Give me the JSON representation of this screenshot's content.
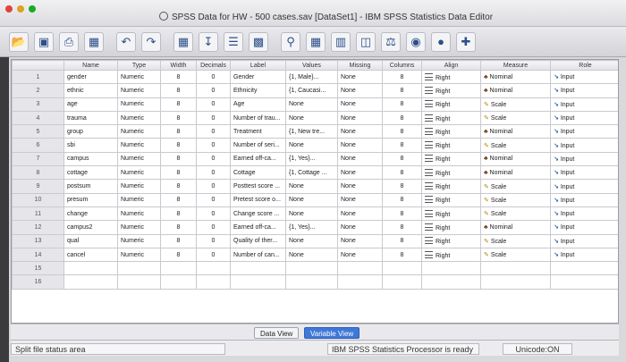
{
  "window": {
    "title": "SPSS Data for HW - 500 cases.sav [DataSet1] - IBM SPSS Statistics Data Editor"
  },
  "toolbar": {
    "icons": [
      "folder-open-icon",
      "save-icon",
      "print-icon",
      "dialog-recall-icon",
      "undo-icon",
      "redo-icon",
      "goto-case-icon",
      "goto-variable-icon",
      "variables-icon",
      "run-descriptives-icon",
      "find-icon",
      "insert-cases-icon",
      "insert-variable-icon",
      "split-file-icon",
      "weight-cases-icon",
      "select-cases-icon",
      "value-labels-icon",
      "use-sets-icon"
    ]
  },
  "grid": {
    "columns": [
      "",
      "Name",
      "Type",
      "Width",
      "Decimals",
      "Label",
      "Values",
      "Missing",
      "Columns",
      "Align",
      "Measure",
      "Role"
    ],
    "rows": [
      {
        "num": "1",
        "name": "gender",
        "type": "Numeric",
        "width": "8",
        "decimals": "0",
        "label": "Gender",
        "values": "{1, Male}...",
        "missing": "None",
        "columns": "8",
        "align": "Right",
        "measure": "Nominal",
        "role": "Input"
      },
      {
        "num": "2",
        "name": "ethnic",
        "type": "Numeric",
        "width": "8",
        "decimals": "0",
        "label": "Ethnicity",
        "values": "{1, Caucasi...",
        "missing": "None",
        "columns": "8",
        "align": "Right",
        "measure": "Nominal",
        "role": "Input"
      },
      {
        "num": "3",
        "name": "age",
        "type": "Numeric",
        "width": "8",
        "decimals": "0",
        "label": "Age",
        "values": "None",
        "missing": "None",
        "columns": "8",
        "align": "Right",
        "measure": "Scale",
        "role": "Input"
      },
      {
        "num": "4",
        "name": "trauma",
        "type": "Numeric",
        "width": "8",
        "decimals": "0",
        "label": "Number of trau...",
        "values": "None",
        "missing": "None",
        "columns": "8",
        "align": "Right",
        "measure": "Scale",
        "role": "Input"
      },
      {
        "num": "5",
        "name": "group",
        "type": "Numeric",
        "width": "8",
        "decimals": "0",
        "label": "Treatment",
        "values": "{1, New tre...",
        "missing": "None",
        "columns": "8",
        "align": "Right",
        "measure": "Nominal",
        "role": "Input"
      },
      {
        "num": "6",
        "name": "sbi",
        "type": "Numeric",
        "width": "8",
        "decimals": "0",
        "label": "Number of seri...",
        "values": "None",
        "missing": "None",
        "columns": "8",
        "align": "Right",
        "measure": "Scale",
        "role": "Input"
      },
      {
        "num": "7",
        "name": "campus",
        "type": "Numeric",
        "width": "8",
        "decimals": "0",
        "label": "Earned off-ca...",
        "values": "{1, Yes}...",
        "missing": "None",
        "columns": "8",
        "align": "Right",
        "measure": "Nominal",
        "role": "Input"
      },
      {
        "num": "8",
        "name": "cottage",
        "type": "Numeric",
        "width": "8",
        "decimals": "0",
        "label": "Cottage",
        "values": "{1, Cottage ...",
        "missing": "None",
        "columns": "8",
        "align": "Right",
        "measure": "Nominal",
        "role": "Input"
      },
      {
        "num": "9",
        "name": "postsum",
        "type": "Numeric",
        "width": "8",
        "decimals": "0",
        "label": "Posttest score ...",
        "values": "None",
        "missing": "None",
        "columns": "8",
        "align": "Right",
        "measure": "Scale",
        "role": "Input"
      },
      {
        "num": "10",
        "name": "presum",
        "type": "Numeric",
        "width": "8",
        "decimals": "0",
        "label": "Pretest score o...",
        "values": "None",
        "missing": "None",
        "columns": "8",
        "align": "Right",
        "measure": "Scale",
        "role": "Input"
      },
      {
        "num": "11",
        "name": "change",
        "type": "Numeric",
        "width": "8",
        "decimals": "0",
        "label": "Change score ...",
        "values": "None",
        "missing": "None",
        "columns": "8",
        "align": "Right",
        "measure": "Scale",
        "role": "Input"
      },
      {
        "num": "12",
        "name": "campus2",
        "type": "Numeric",
        "width": "8",
        "decimals": "0",
        "label": "Earned off-ca...",
        "values": "{1, Yes}...",
        "missing": "None",
        "columns": "8",
        "align": "Right",
        "measure": "Nominal",
        "role": "Input"
      },
      {
        "num": "13",
        "name": "qual",
        "type": "Numeric",
        "width": "8",
        "decimals": "0",
        "label": "Quality of ther...",
        "values": "None",
        "missing": "None",
        "columns": "8",
        "align": "Right",
        "measure": "Scale",
        "role": "Input"
      },
      {
        "num": "14",
        "name": "cancel",
        "type": "Numeric",
        "width": "8",
        "decimals": "0",
        "label": "Number of can...",
        "values": "None",
        "missing": "None",
        "columns": "8",
        "align": "Right",
        "measure": "Scale",
        "role": "Input"
      },
      {
        "num": "15",
        "name": "",
        "type": "",
        "width": "",
        "decimals": "",
        "label": "",
        "values": "",
        "missing": "",
        "columns": "",
        "align": "",
        "measure": "",
        "role": ""
      },
      {
        "num": "16",
        "name": "",
        "type": "",
        "width": "",
        "decimals": "",
        "label": "",
        "values": "",
        "missing": "",
        "columns": "",
        "align": "",
        "measure": "",
        "role": ""
      }
    ]
  },
  "tabs": {
    "data_view": "Data View",
    "variable_view": "Variable View",
    "active": "Variable View"
  },
  "status": {
    "split": "Split file status area",
    "processor": "IBM SPSS Statistics Processor is ready",
    "encoding": "Unicode:ON"
  },
  "colors": {
    "active_tab": "#3f78d9",
    "nominal": "#6a3a1a",
    "scale": "#b58a10",
    "role": "#2c5aa8"
  }
}
